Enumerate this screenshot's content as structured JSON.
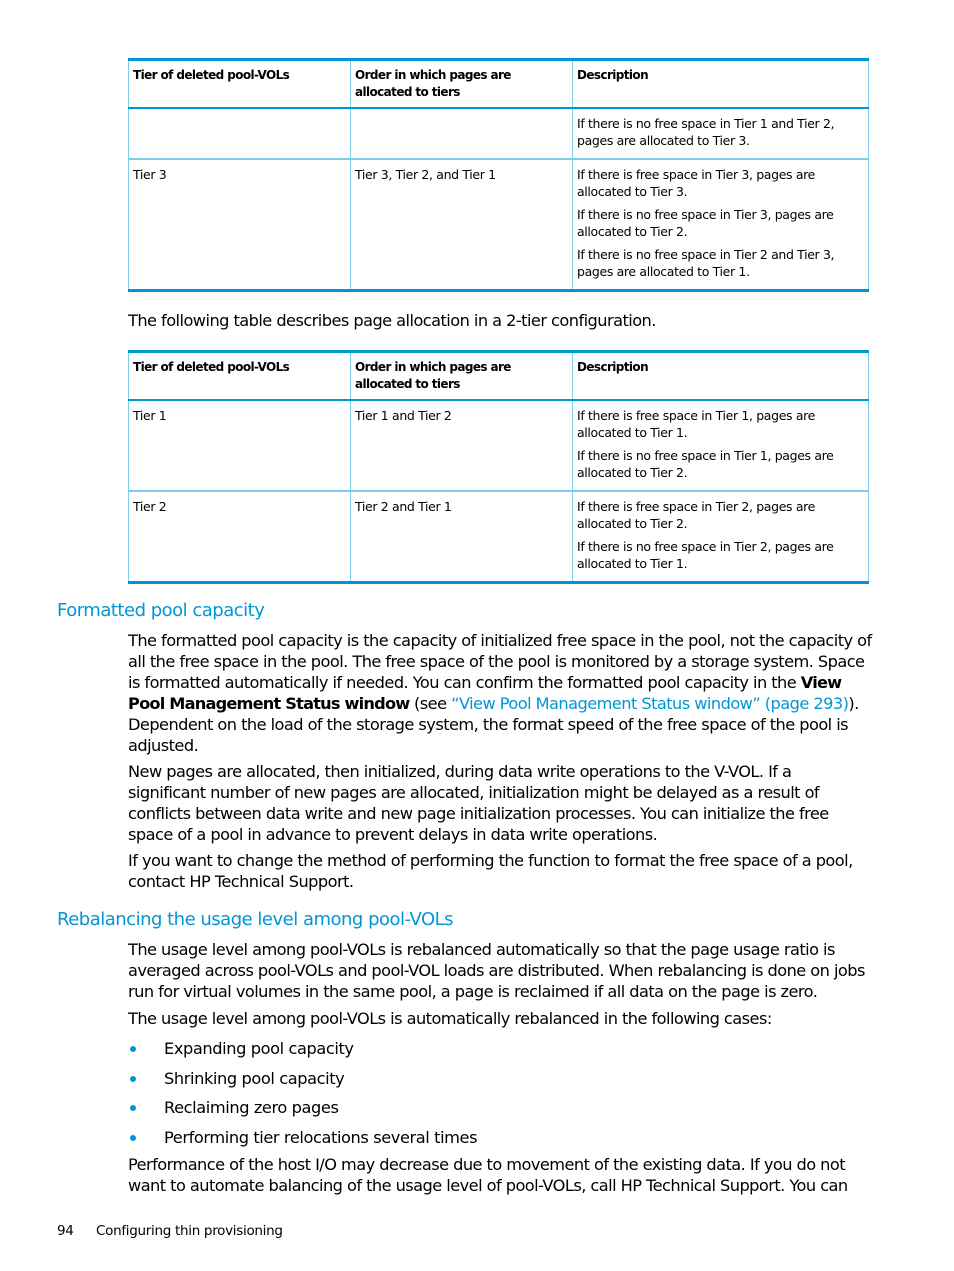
{
  "table_3tier": {
    "headers": [
      "Tier of deleted pool-VOLs",
      "Order in which pages are allocated to tiers",
      "Description"
    ],
    "rows": [
      {
        "tier": "",
        "order": "",
        "description": [
          "If there is no free space in Tier 1 and Tier 2, pages are allocated to Tier 3."
        ]
      },
      {
        "tier": "Tier 3",
        "order": "Tier 3, Tier 2, and Tier 1",
        "description": [
          "If there is free space in Tier 3, pages are allocated to Tier 3.",
          "If there is no free space in Tier 3, pages are allocated to Tier 2.",
          "If there is no free space in Tier 2 and Tier 3, pages are allocated to Tier 1."
        ]
      }
    ]
  },
  "intro_2tier": "The following table describes page allocation in a 2-tier configuration.",
  "table_2tier": {
    "headers": [
      "Tier of deleted pool-VOLs",
      "Order in which pages are allocated to tiers",
      "Description"
    ],
    "rows": [
      {
        "tier": "Tier 1",
        "order": "Tier 1 and Tier 2",
        "description": [
          "If there is free space in Tier 1, pages are allocated to Tier 1.",
          "If there is no free space in Tier 1, pages are allocated to Tier 2."
        ]
      },
      {
        "tier": "Tier 2",
        "order": "Tier 2 and Tier 1",
        "description": [
          "If there is free space in Tier 2, pages are allocated to Tier 2.",
          "If there is no free space in Tier 2, pages are allocated to Tier 1."
        ]
      }
    ]
  },
  "section_formatted": {
    "heading": "Formatted pool capacity",
    "p1_before": "The formatted pool capacity is the capacity of initialized free space in the pool, not the capacity of all the free space in the pool. The free space of the pool is monitored by a storage system. Space is formatted automatically if needed. You can confirm the formatted pool capacity in the ",
    "p1_bold": "View Pool Management Status window",
    "p1_see": " (see ",
    "p1_link": "“View Pool Management Status window” (page 293)",
    "p1_after": "). Dependent on the load of the storage system, the format speed of the free space of the pool is adjusted.",
    "p2": "New pages are allocated, then initialized, during data write operations to the V-VOL. If a significant number of new pages are allocated, initialization might be delayed as a result of conflicts between data write and new page initialization processes. You can initialize the free space of a pool in advance to prevent delays in data write operations.",
    "p3": "If you want to change the method of performing the function to format the free space of a pool, contact HP Technical Support."
  },
  "section_rebalancing": {
    "heading": "Rebalancing the usage level among pool-VOLs",
    "p1": "The usage level among pool-VOLs is rebalanced automatically so that the page usage ratio is averaged across pool-VOLs and pool-VOL loads are distributed. When rebalancing is done on jobs run for virtual volumes in the same pool, a page is reclaimed if all data on the page is zero.",
    "p2": "The usage level among pool-VOLs is automatically rebalanced in the following cases:",
    "bullets": [
      "Expanding pool capacity",
      "Shrinking pool capacity",
      "Reclaiming zero pages",
      "Performing tier relocations several times"
    ],
    "p3": "Performance of the host I/O may decrease due to movement of the existing data. If you do not want to automate balancing of the usage level of pool-VOLs, call HP Technical Support. You can"
  },
  "footer": {
    "page_number": "94",
    "chapter": "Configuring thin provisioning"
  },
  "colors": {
    "accent": "#0096d6",
    "table_inner_rule": "#7fcbea"
  }
}
